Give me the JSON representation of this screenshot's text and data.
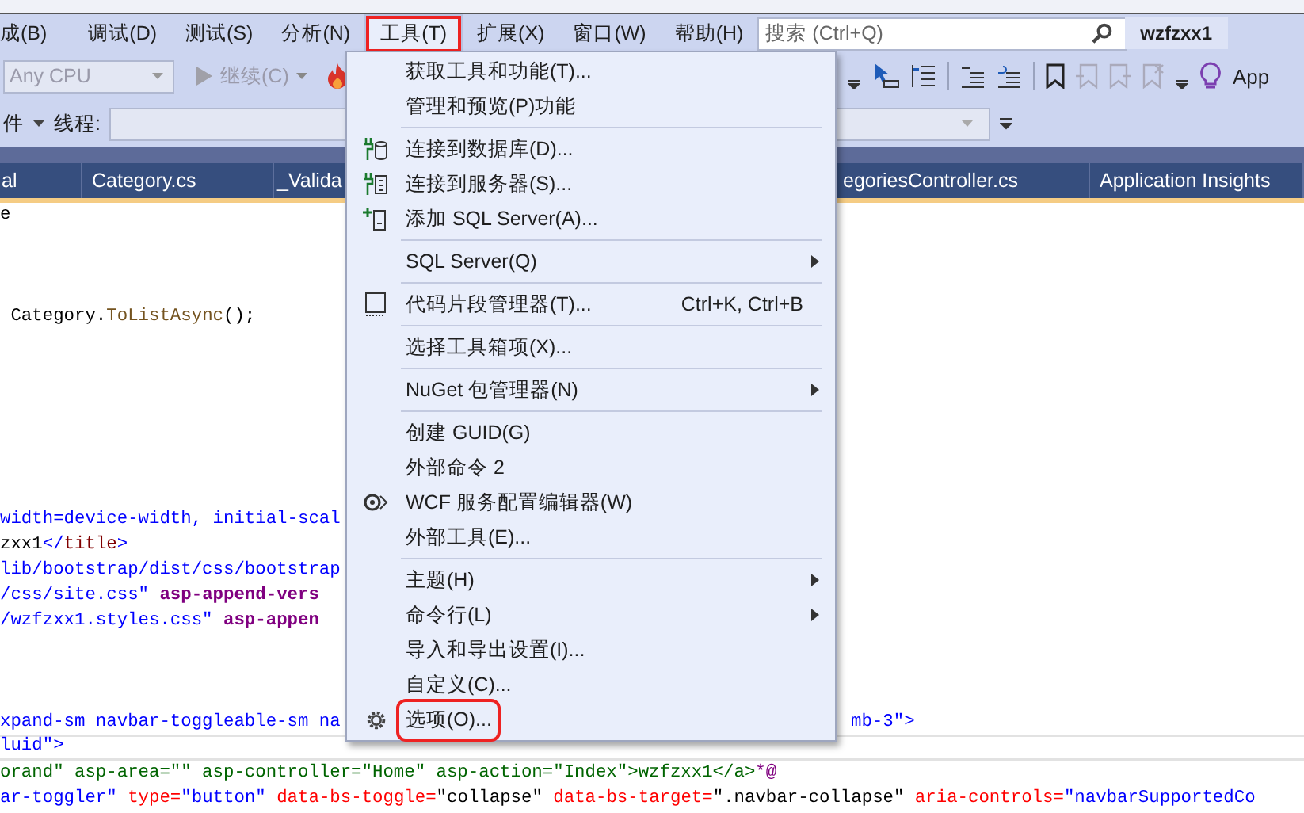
{
  "menu_bar": [
    {
      "label": "成(B)",
      "selected": false,
      "highlighted": false
    },
    {
      "label": "调试(D)",
      "selected": false,
      "highlighted": false
    },
    {
      "label": "测试(S)",
      "selected": false,
      "highlighted": false
    },
    {
      "label": "分析(N)",
      "selected": false,
      "highlighted": false
    },
    {
      "label": "工具(T)",
      "selected": true,
      "highlighted": true
    },
    {
      "label": "扩展(X)",
      "selected": false,
      "highlighted": false
    },
    {
      "label": "窗口(W)",
      "selected": false,
      "highlighted": false
    },
    {
      "label": "帮助(H)",
      "selected": false,
      "highlighted": false
    }
  ],
  "search": {
    "placeholder": "搜索 (Ctrl+Q)"
  },
  "solution_name": "wzfzxx1",
  "toolbar": {
    "platform": "Any CPU",
    "continue_label": "继续(C)",
    "app_label": "App"
  },
  "debug_row": {
    "file_label": "件",
    "thread_label": "线程:"
  },
  "tabs": [
    {
      "label": "al"
    },
    {
      "label": "Category.cs"
    },
    {
      "label": "_Valida"
    },
    {
      "label": "egoriesController.cs"
    },
    {
      "label": "Application Insights"
    }
  ],
  "code_lines": [
    {
      "segments": [
        {
          "kind": "text",
          "text": "e"
        }
      ]
    },
    {
      "blank": true
    },
    {
      "blank": true
    },
    {
      "blank": true
    },
    {
      "segments": [
        {
          "kind": "text",
          "text": " Category."
        },
        {
          "kind": "method",
          "text": "ToListAsync"
        },
        {
          "kind": "text",
          "text": "();"
        }
      ]
    },
    {
      "blank": true
    },
    {
      "blank": true
    },
    {
      "blank": true
    },
    {
      "blank": true
    },
    {
      "blank": true
    },
    {
      "blank": true
    },
    {
      "blank": true
    },
    {
      "segments": [
        {
          "kind": "value",
          "text": "width=device-width, initial-scal"
        }
      ]
    },
    {
      "segments": [
        {
          "kind": "text",
          "text": "zxx1"
        },
        {
          "kind": "delimiter",
          "text": "</"
        },
        {
          "kind": "element",
          "text": "title"
        },
        {
          "kind": "delimiter",
          "text": ">"
        }
      ]
    },
    {
      "segments": [
        {
          "kind": "value",
          "text": "lib/bootstrap/dist/css/bootstrap"
        }
      ]
    },
    {
      "segments": [
        {
          "kind": "value",
          "text": "/css/site.css\""
        },
        {
          "kind": "razor-attr",
          "text": " asp-append-vers"
        }
      ]
    },
    {
      "segments": [
        {
          "kind": "value",
          "text": "/wzfzxx1.styles.css\""
        },
        {
          "kind": "razor-attr",
          "text": " asp-appen"
        }
      ]
    },
    {
      "blank": true
    },
    {
      "blank": true
    },
    {
      "blank": true
    },
    {
      "segments": [
        {
          "kind": "value",
          "text": "xpand-sm navbar-toggleable-sm na"
        }
      ],
      "right_segments": [
        {
          "kind": "value",
          "text": "mb-3\">"
        }
      ]
    },
    {
      "current": true,
      "segments": [
        {
          "kind": "value",
          "text": "luid\""
        },
        {
          "kind": "delimiter",
          "text": ">"
        }
      ]
    },
    {
      "segments": [
        {
          "kind": "comment",
          "text": "orand\" asp-area=\"\" asp-controller=\"Home\" asp-action=\"Index\">wzfzxx1</a>"
        },
        {
          "kind": "razor",
          "text": "*@"
        }
      ]
    },
    {
      "segments": [
        {
          "kind": "value",
          "text": "ar-toggler\""
        },
        {
          "kind": "attr",
          "text": " type="
        },
        {
          "kind": "value",
          "text": "\"button\""
        },
        {
          "kind": "attr",
          "text": " data-bs-toggle="
        },
        {
          "kind": "text",
          "text": "\"collapse\""
        },
        {
          "kind": "attr",
          "text": " data-bs-target="
        },
        {
          "kind": "text",
          "text": "\".navbar-collapse\""
        },
        {
          "kind": "attr",
          "text": " aria-controls="
        },
        {
          "kind": "value",
          "text": "\"navbarSupportedCo"
        }
      ]
    }
  ],
  "tools_menu": {
    "items": [
      {
        "kind": "item",
        "label": "获取工具和功能(T)..."
      },
      {
        "kind": "item",
        "label": "管理和预览(P)功能"
      },
      {
        "kind": "separator"
      },
      {
        "kind": "item",
        "label": "连接到数据库(D)..."
      },
      {
        "kind": "item",
        "label": "连接到服务器(S)..."
      },
      {
        "kind": "item",
        "label": "添加 SQL Server(A)..."
      },
      {
        "kind": "separator"
      },
      {
        "kind": "item",
        "label": "SQL Server(Q)",
        "submenu": true
      },
      {
        "kind": "separator"
      },
      {
        "kind": "item",
        "label": "代码片段管理器(T)...",
        "shortcut": "Ctrl+K, Ctrl+B"
      },
      {
        "kind": "separator"
      },
      {
        "kind": "item",
        "label": "选择工具箱项(X)..."
      },
      {
        "kind": "separator"
      },
      {
        "kind": "item",
        "label": "NuGet 包管理器(N)",
        "submenu": true
      },
      {
        "kind": "separator"
      },
      {
        "kind": "item",
        "label": "创建 GUID(G)"
      },
      {
        "kind": "item",
        "label": "外部命令 2"
      },
      {
        "kind": "item",
        "label": "WCF 服务配置编辑器(W)"
      },
      {
        "kind": "item",
        "label": "外部工具(E)..."
      },
      {
        "kind": "separator"
      },
      {
        "kind": "item",
        "label": "主题(H)",
        "submenu": true
      },
      {
        "kind": "item",
        "label": "命令行(L)",
        "submenu": true
      },
      {
        "kind": "item",
        "label": "导入和导出设置(I)..."
      },
      {
        "kind": "item",
        "label": "自定义(C)..."
      },
      {
        "kind": "item",
        "label": "选项(O)...",
        "highlighted": true
      }
    ]
  }
}
